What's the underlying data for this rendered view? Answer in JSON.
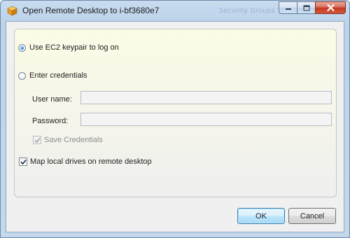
{
  "window": {
    "title": "Open Remote Desktop to i-bf3680e7",
    "background_hint_text": "Security Groups"
  },
  "options": {
    "use_keypair": {
      "label": "Use EC2 keypair to log on",
      "selected": true
    },
    "enter_credentials": {
      "label": "Enter credentials",
      "selected": false
    }
  },
  "credentials": {
    "username_label": "User name:",
    "username_value": "",
    "password_label": "Password:",
    "password_value": "",
    "save_credentials_label": "Save Credentials",
    "save_credentials_checked": true,
    "save_credentials_enabled": false
  },
  "map_drives": {
    "label": "Map local drives on remote desktop",
    "checked": true
  },
  "buttons": {
    "ok_label": "OK",
    "cancel_label": "Cancel"
  },
  "icons": {
    "app": "aws-cube-icon",
    "minimize": "minimize-icon",
    "maximize": "maximize-icon",
    "close": "close-icon"
  },
  "colors": {
    "title_gradient_top": "#c9dcef",
    "panel_tint": "#fbfbe6",
    "default_button_border": "#3c7fb1",
    "close_button": "#c4371d"
  }
}
